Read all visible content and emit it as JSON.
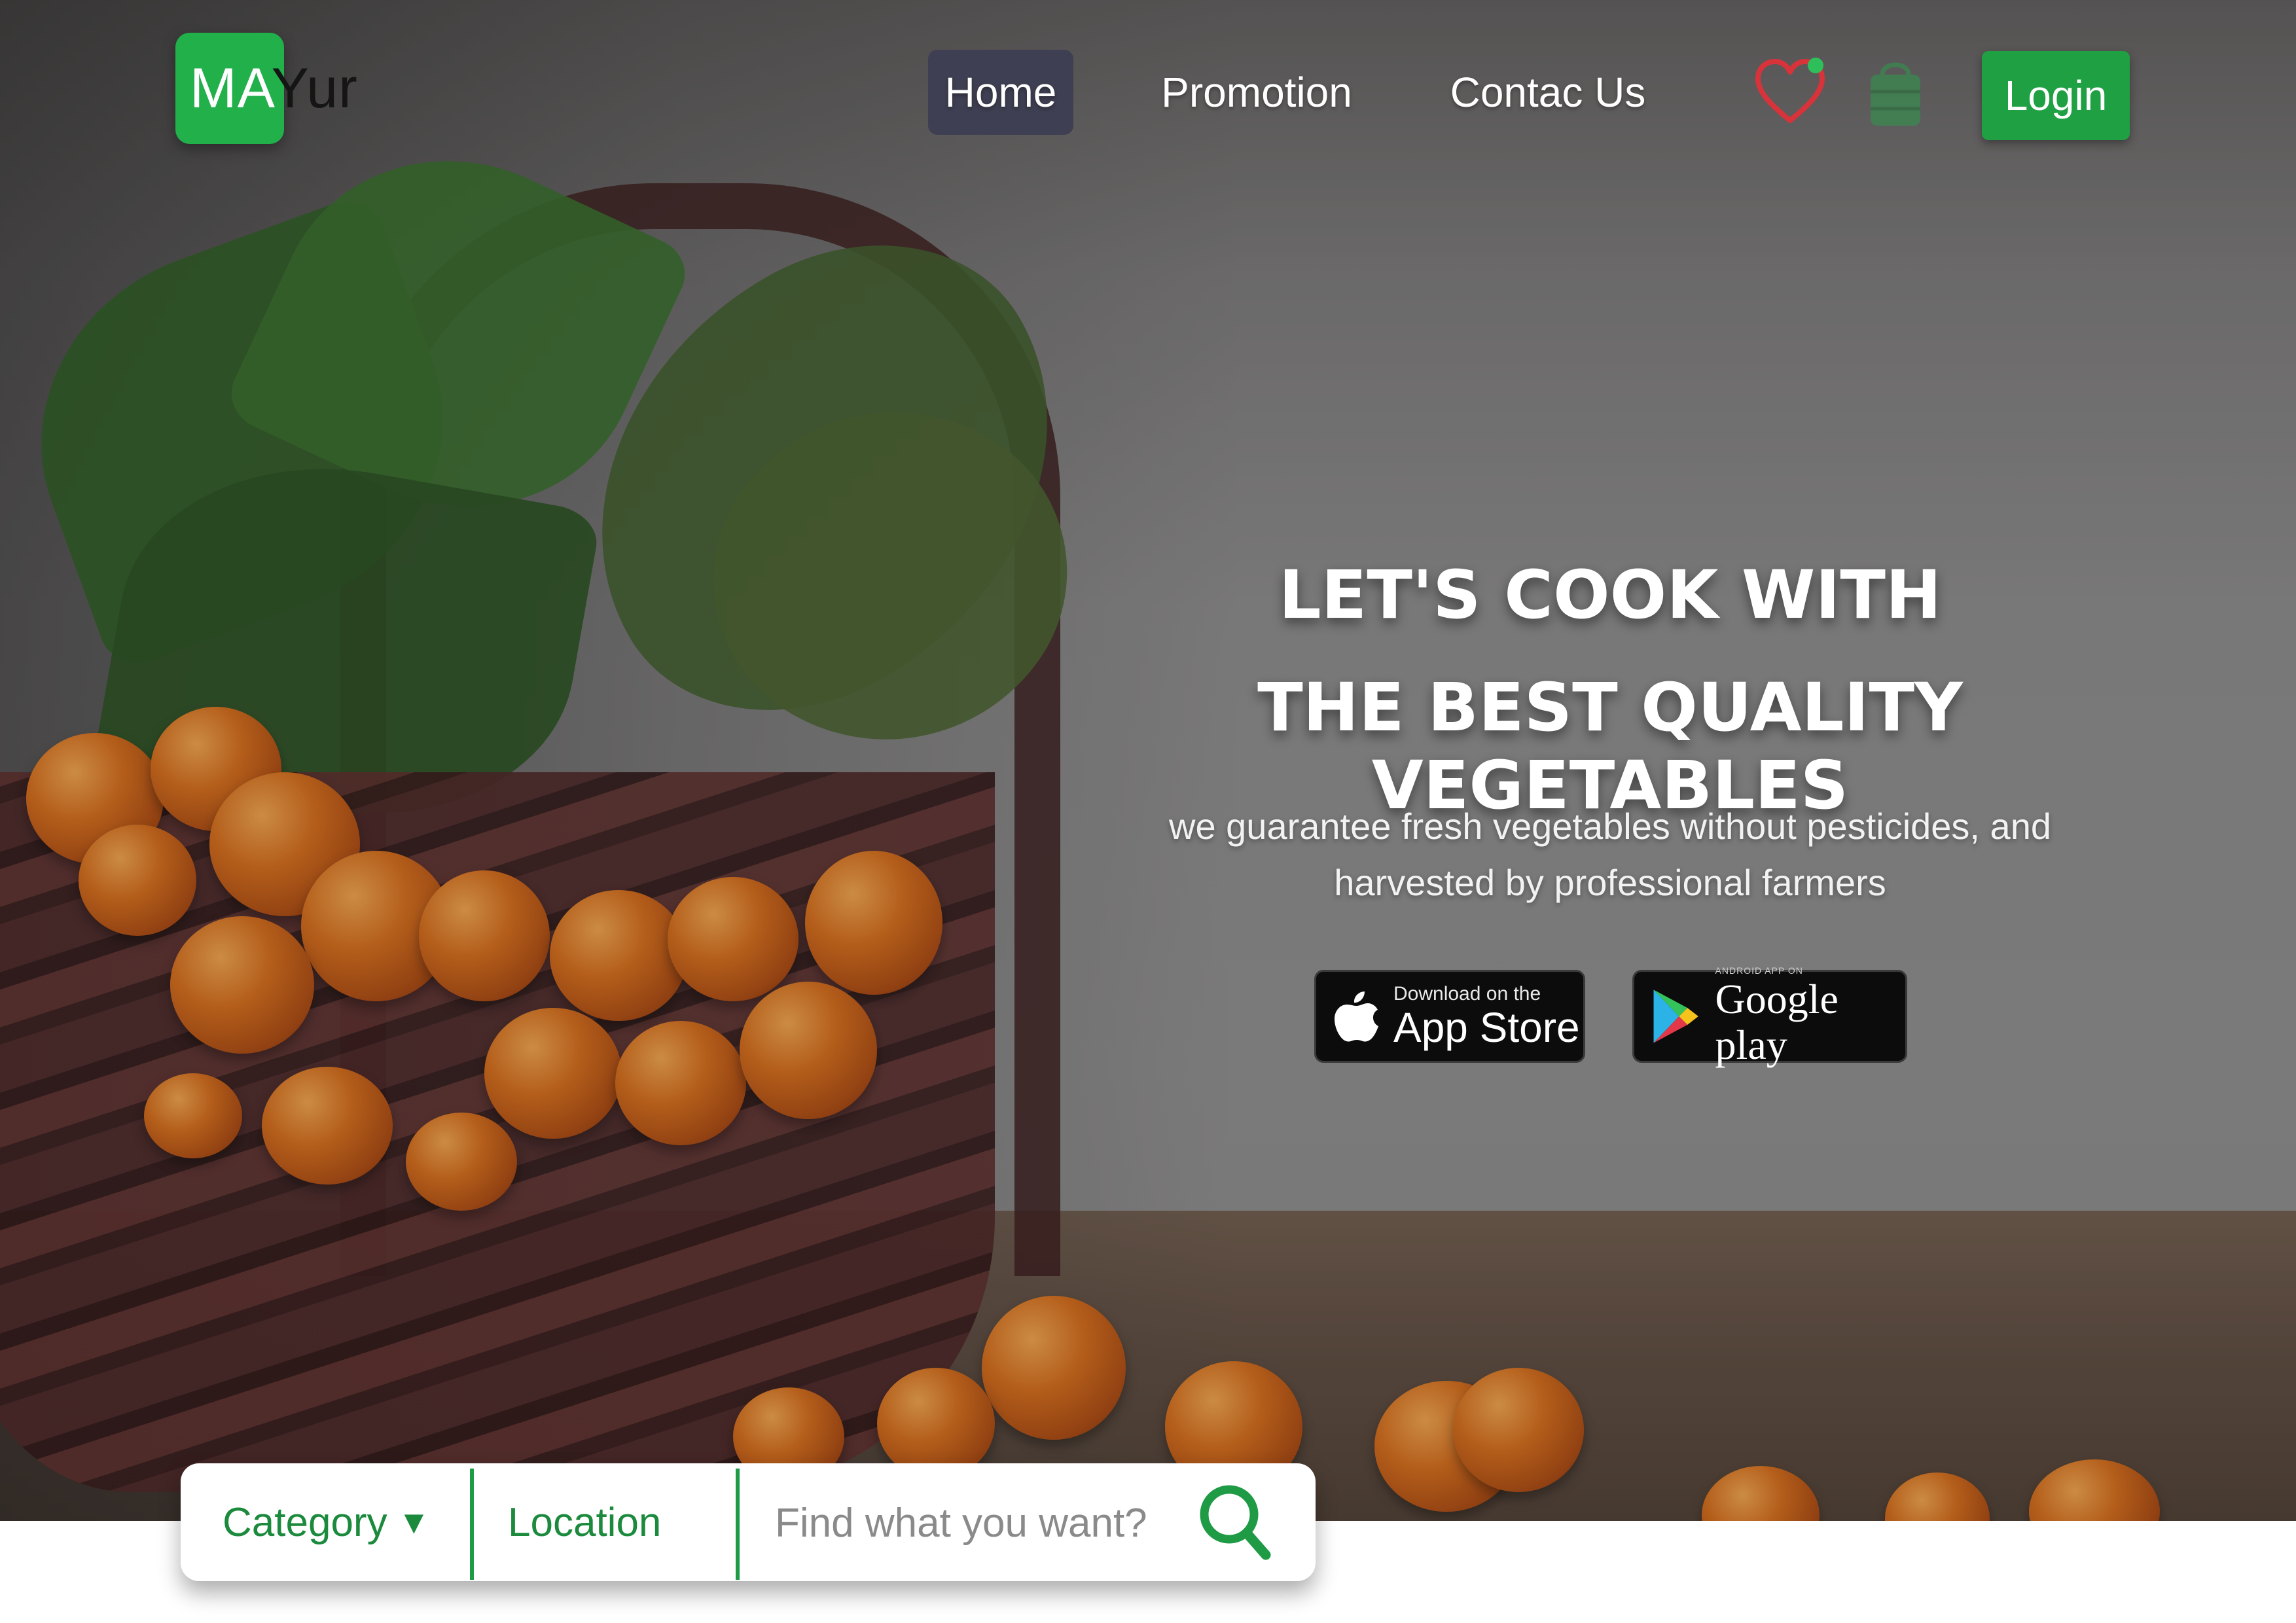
{
  "brand": {
    "logo_part1": "MA",
    "logo_part2": "Yur",
    "accent_color": "#22b04b"
  },
  "nav": {
    "items": [
      {
        "label": "Home",
        "active": true
      },
      {
        "label": "Promotion",
        "active": false
      },
      {
        "label": "Contac Us",
        "active": false
      }
    ],
    "icons": [
      "heart-icon",
      "basket-icon"
    ],
    "login_label": "Login"
  },
  "hero": {
    "headline_line1": "LET'S COOK WITH",
    "headline_line2": "THE BEST QUALITY VEGETABLES",
    "subtext": "we guarantee fresh vegetables without pesticides, and harvested by professional farmers"
  },
  "stores": {
    "appstore_small": "Download on the",
    "appstore_big": "App Store",
    "googleplay_small": "ANDROID APP ON",
    "googleplay_big": "Google play"
  },
  "search": {
    "category_label": "Category",
    "location_label": "Location",
    "placeholder": "Find what you want?"
  }
}
